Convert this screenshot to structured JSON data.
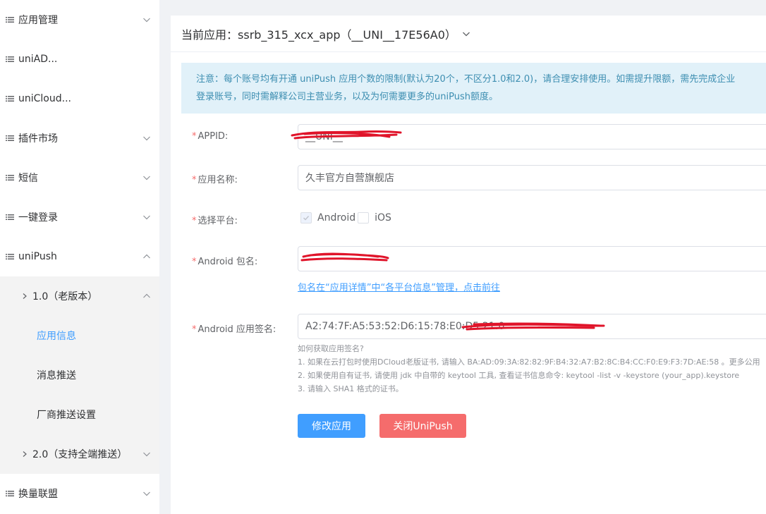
{
  "sidebar": {
    "items": [
      {
        "label": "应用管理"
      },
      {
        "label": "uniAD..."
      },
      {
        "label": "uniCloud..."
      },
      {
        "label": "插件市场"
      },
      {
        "label": "短信"
      },
      {
        "label": "一键登录"
      },
      {
        "label": "uniPush"
      }
    ],
    "unipush_sub": {
      "v1_label": "1.0（老版本）",
      "v1_items": [
        {
          "label": "应用信息"
        },
        {
          "label": "消息推送"
        },
        {
          "label": "厂商推送设置"
        }
      ],
      "v2_label": "2.0（支持全端推送）"
    },
    "bottom_item": {
      "label": "换量联盟"
    }
  },
  "header": {
    "current_app_label": "当前应用：",
    "current_app_value": "ssrb_315_xcx_app（__UNI__17E56A0）"
  },
  "notice": {
    "line1": "注意：每个账号均有开通 uniPush 应用个数的限制(默认为20个，不区分1.0和2.0)，请合理安排使用。如需提升限额，需先完成企业",
    "line2": "登录账号，同时需解释公司主营业务，以及为何需要更多的uniPush额度。"
  },
  "form": {
    "appid": {
      "label": "APPID:",
      "value": "__UNI__"
    },
    "app_name": {
      "label": "应用名称:",
      "value": "久丰官方自营旗舰店"
    },
    "platform": {
      "label": "选择平台:",
      "android_label": "Android",
      "ios_label": "iOS",
      "android_checked": true,
      "ios_checked": false
    },
    "android_package": {
      "label": "Android 包名:",
      "value": ""
    },
    "package_link": "包名在“应用详情”中“各平台信息”管理，点击前往",
    "android_signature": {
      "label": "Android 应用签名:",
      "value": "A2:74:7F:A5:53:52:D6:15:78:E0:D5:21:0"
    }
  },
  "help": {
    "title": "如何获取应用签名?",
    "line1": "1. 如果在云打包时使用DCloud老版证书, 请输入 BA:AD:09:3A:82:82:9F:B4:32:A7:B2:8C:B4:CC:F0:E9:F3:7D:AE:58 。更多公用",
    "line2": "2. 如果使用自有证书, 请使用 jdk 中自带的 keytool 工具, 查看证书信息命令: keytool -list -v -keystore (your_app).keystore",
    "line3": "3. 请输入 SHA1 格式的证书。"
  },
  "buttons": {
    "modify": "修改应用",
    "close": "关闭UniPush"
  },
  "colors": {
    "primary": "#409eff",
    "danger": "#f56c6c",
    "notice_bg": "#e1f1f9",
    "notice_text": "#3d8eb1",
    "required": "#f56c6c"
  }
}
